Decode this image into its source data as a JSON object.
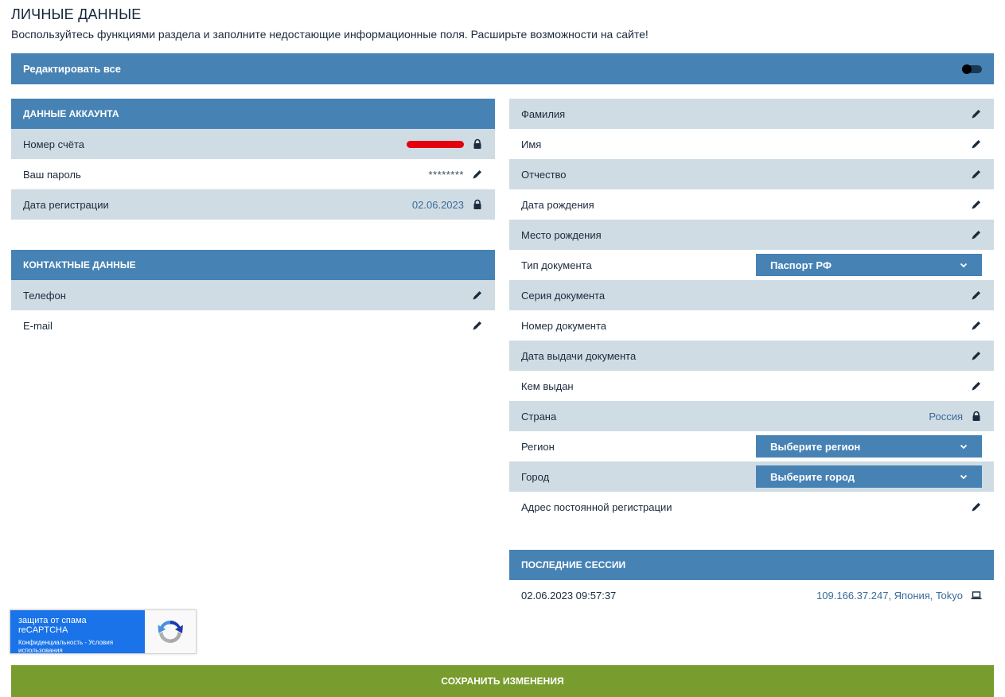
{
  "page": {
    "title": "ЛИЧНЫЕ ДАННЫЕ",
    "subtitle": "Воспользуйтесь функциями раздела и заполните недостающие информационные поля. Расширьте возможности на сайте!"
  },
  "edit_all": {
    "label": "Редактировать все",
    "enabled": false
  },
  "account": {
    "header": "ДАННЫЕ АККАУНТА",
    "account_number_label": "Номер счёта",
    "password_label": "Ваш пароль",
    "password_value": "********",
    "registration_date_label": "Дата регистрации",
    "registration_date_value": "02.06.2023"
  },
  "contacts": {
    "header": "КОНТАКТНЫЕ ДАННЫЕ",
    "phone_label": "Телефон",
    "email_label": "E-mail"
  },
  "personal": {
    "surname_label": "Фамилия",
    "name_label": "Имя",
    "patronymic_label": "Отчество",
    "birth_date_label": "Дата рождения",
    "birth_place_label": "Место рождения",
    "doc_type_label": "Тип документа",
    "doc_type_value": "Паспорт РФ",
    "doc_series_label": "Серия документа",
    "doc_number_label": "Номер документа",
    "doc_issue_date_label": "Дата выдачи документа",
    "doc_issued_by_label": "Кем выдан",
    "country_label": "Страна",
    "country_value": "Россия",
    "region_label": "Регион",
    "region_placeholder": "Выберите регион",
    "city_label": "Город",
    "city_placeholder": "Выберите город",
    "address_label": "Адрес постоянной регистрации"
  },
  "sessions": {
    "header": "ПОСЛЕДНИЕ СЕССИИ",
    "items": [
      {
        "datetime": "02.06.2023 09:57:37",
        "location": "109.166.37.247, Япония, Tokyo"
      }
    ]
  },
  "recaptcha": {
    "title": "защита от спама reCAPTCHA",
    "links": "Конфиденциальность - Условия использования"
  },
  "save_button": "СОХРАНИТЬ ИЗМЕНЕНИЯ",
  "colors": {
    "accent": "#4682b4",
    "row_alt": "#d0dce4",
    "save": "#789c2e",
    "value_link": "#3a6a9a"
  }
}
